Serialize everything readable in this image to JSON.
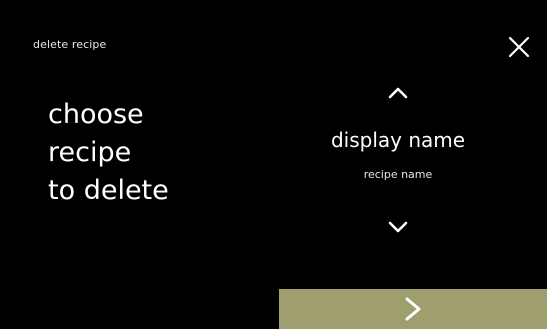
{
  "header": {
    "title": "delete recipe",
    "close_icon": "close-icon"
  },
  "instruction": {
    "lines": [
      "choose",
      "recipe",
      "to delete"
    ]
  },
  "selector": {
    "up_icon": "chevron-up-icon",
    "display_name": "display name",
    "recipe_name": "recipe name",
    "down_icon": "chevron-down-icon"
  },
  "footer": {
    "next_icon": "chevron-right-icon"
  },
  "colors": {
    "background": "#000000",
    "text": "#ffffff",
    "next_button": "#9f9e6f"
  }
}
